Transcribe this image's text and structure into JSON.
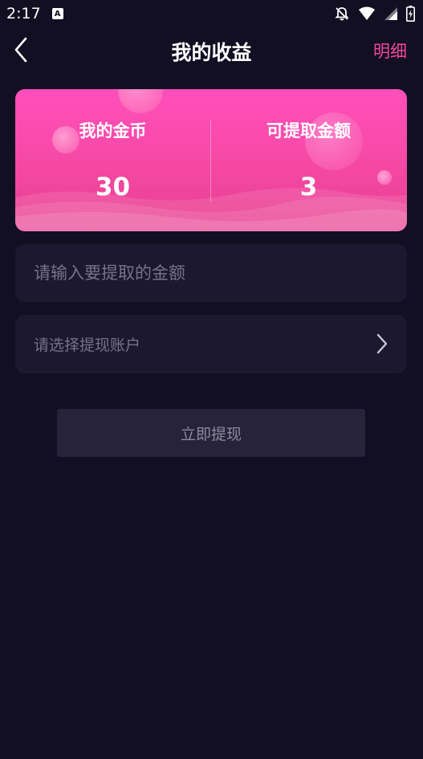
{
  "status_bar": {
    "time": "2:17",
    "a_icon_label": "A"
  },
  "header": {
    "title": "我的收益",
    "detail_link": "明细"
  },
  "earnings_card": {
    "coins_label": "我的金币",
    "coins_value": "30",
    "withdrawable_label": "可提取金额",
    "withdrawable_value": "3"
  },
  "amount_input": {
    "placeholder": "请输入要提取的金额",
    "value": ""
  },
  "account_select": {
    "label": "请选择提现账户"
  },
  "withdraw_button": {
    "label": "立即提现"
  },
  "colors": {
    "background": "#120f23",
    "card_pink": "#f74aa8",
    "accent": "#f0479c",
    "field_bg": "#1b1830",
    "button_bg": "#26233a"
  }
}
